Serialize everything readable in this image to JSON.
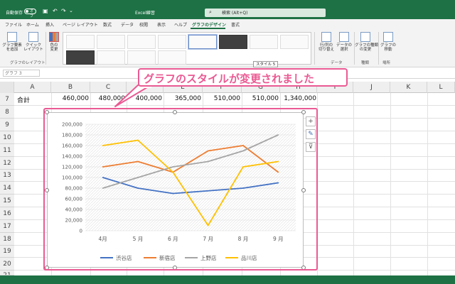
{
  "titlebar": {
    "autosave_label": "自動保存",
    "autosave_state": "オフ",
    "filename": "Excel練習",
    "search_placeholder": "検索 (Alt+Q)"
  },
  "tabs": [
    "ファイル",
    "ホーム",
    "挿入",
    "ページ レイアウト",
    "数式",
    "データ",
    "校閲",
    "表示",
    "ヘルプ",
    "グラフのデザイン",
    "書式"
  ],
  "ribbon": {
    "add_element": "グラフ要素\nを追加",
    "quick_layout": "クイック\nレイアウト",
    "change_color": "色の\n変更",
    "layout_group": "グラフのレイアウト",
    "switch_rowcol": "行/列の\n切り替え",
    "select_data": "データの\n選択",
    "data_group": "データ",
    "change_type": "グラフの種類\nの変更",
    "type_group": "種類",
    "move_chart": "グラフの\n移動",
    "location_group": "場所",
    "style_tooltip": "スタイル 5"
  },
  "namebox": "グラフ 3",
  "callout": "グラフのスタイルが変更されました",
  "columns": [
    "A",
    "B",
    "C",
    "D",
    "E",
    "F",
    "G",
    "H",
    "I",
    "J",
    "K",
    "L"
  ],
  "rows": [
    "7",
    "8",
    "9",
    "10",
    "11",
    "12",
    "13",
    "14",
    "15",
    "16",
    "17",
    "18",
    "19",
    "20",
    "21"
  ],
  "row7": [
    "合計",
    "460,000",
    "480,000",
    "400,000",
    "365,000",
    "510,000",
    "510,000",
    "1,340,000"
  ],
  "colors": {
    "excel_green": "#1e7145",
    "callout_pink": "#ea5a93"
  },
  "chart_data": {
    "type": "line",
    "categories": [
      "4月",
      "5 月",
      "6 月",
      "7 月",
      "8 月",
      "9 月"
    ],
    "ylim": [
      0,
      200000
    ],
    "yticks": [
      "0",
      "20,000",
      "40,000",
      "60,000",
      "80,000",
      "100,000",
      "120,000",
      "140,000",
      "160,000",
      "180,000",
      "200,000"
    ],
    "series": [
      {
        "name": "渋谷店",
        "color": "#4472c4",
        "values": [
          100000,
          80000,
          70000,
          75000,
          80000,
          90000
        ]
      },
      {
        "name": "新宿店",
        "color": "#ed7d31",
        "values": [
          120000,
          130000,
          110000,
          150000,
          160000,
          110000
        ]
      },
      {
        "name": "上野店",
        "color": "#a5a5a5",
        "values": [
          80000,
          100000,
          120000,
          130000,
          150000,
          180000
        ]
      },
      {
        "name": "品川店",
        "color": "#ffc000",
        "values": [
          160000,
          170000,
          110000,
          10000,
          120000,
          130000
        ]
      }
    ],
    "legend": "bottom",
    "grid": true
  }
}
